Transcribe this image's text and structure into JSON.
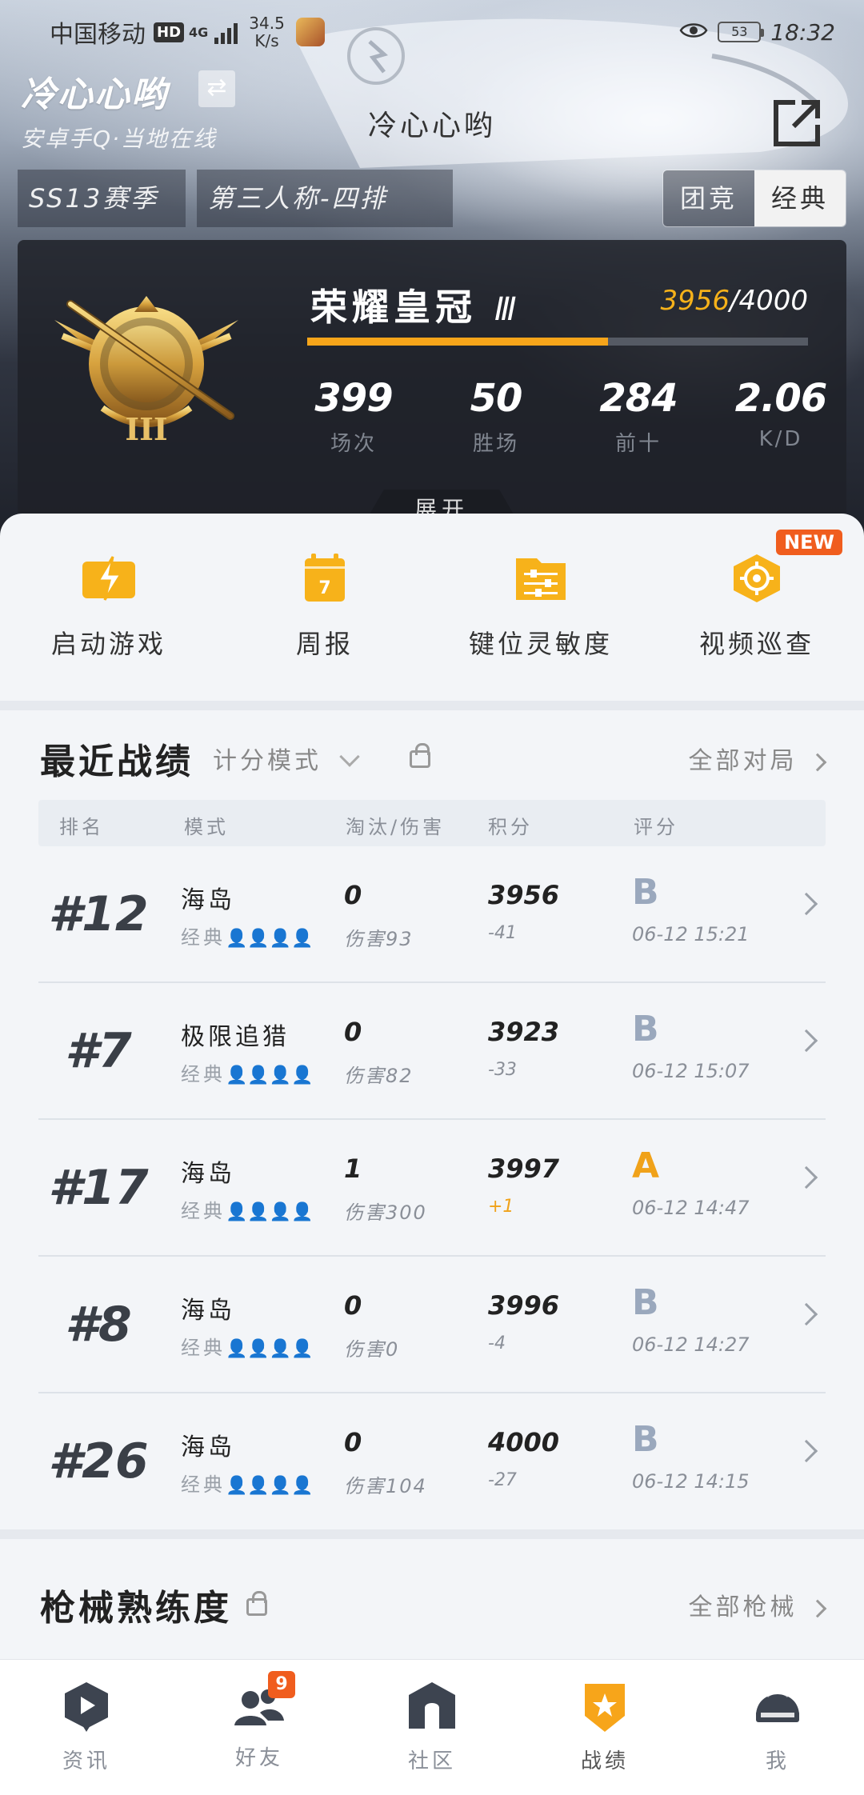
{
  "status_bar": {
    "carrier": "中国移动",
    "hd": "HD",
    "network": "4G",
    "speed_value": "34.5",
    "speed_unit": "K/s",
    "battery": "53",
    "time": "18:32"
  },
  "header": {
    "player_name": "冷心心哟",
    "online_status": "安卓手Q·当地在线",
    "title": "冷心心哟"
  },
  "filters": {
    "season": "SS13赛季",
    "mode": "第三人称-四排",
    "segments": [
      "团竞",
      "经典"
    ],
    "selected_segment": "经典"
  },
  "rank": {
    "name": "荣耀皇冠",
    "level": "Ⅲ",
    "badge_numeral": "III",
    "score_current": "3956",
    "score_max": "/4000",
    "progress": 0.6,
    "stats": [
      {
        "value": "399",
        "label": "场次"
      },
      {
        "value": "50",
        "label": "胜场"
      },
      {
        "value": "284",
        "label": "前十"
      },
      {
        "value": "2.06",
        "label": "K/D"
      }
    ],
    "expand_label": "展开"
  },
  "quick_actions": [
    {
      "label": "启动游戏",
      "icon": "lightning-icon"
    },
    {
      "label": "周报",
      "icon": "calendar-icon",
      "day": "7"
    },
    {
      "label": "键位灵敏度",
      "icon": "sliders-icon"
    },
    {
      "label": "视频巡查",
      "icon": "target-icon"
    }
  ],
  "new_tag": "NEW",
  "recent": {
    "title": "最近战绩",
    "mode_filter": "计分模式",
    "more": "全部对局",
    "columns": [
      "排名",
      "模式",
      "淘汰/伤害",
      "积分",
      "评分"
    ],
    "rows": [
      {
        "rank": "#12",
        "map": "海岛",
        "mode": "经典",
        "kills": "0",
        "damage": "伤害93",
        "points": "3956",
        "delta": "-41",
        "grade": "B",
        "time": "06-12 15:21"
      },
      {
        "rank": "#7",
        "map": "极限追猎",
        "mode": "经典",
        "kills": "0",
        "damage": "伤害82",
        "points": "3923",
        "delta": "-33",
        "grade": "B",
        "time": "06-12 15:07"
      },
      {
        "rank": "#17",
        "map": "海岛",
        "mode": "经典",
        "kills": "1",
        "damage": "伤害300",
        "points": "3997",
        "delta": "+1",
        "grade": "A",
        "time": "06-12 14:47"
      },
      {
        "rank": "#8",
        "map": "海岛",
        "mode": "经典",
        "kills": "0",
        "damage": "伤害0",
        "points": "3996",
        "delta": "-4",
        "grade": "B",
        "time": "06-12 14:27"
      },
      {
        "rank": "#26",
        "map": "海岛",
        "mode": "经典",
        "kills": "0",
        "damage": "伤害104",
        "points": "4000",
        "delta": "-27",
        "grade": "B",
        "time": "06-12 14:15"
      }
    ]
  },
  "weapons": {
    "title": "枪械熟练度",
    "more": "全部枪械"
  },
  "bottom_nav": {
    "items": [
      {
        "label": "资讯"
      },
      {
        "label": "好友",
        "badge": "9"
      },
      {
        "label": "社区"
      },
      {
        "label": "战绩"
      },
      {
        "label": "我"
      }
    ],
    "active": "战绩"
  },
  "colors": {
    "accent": "#f7a51a",
    "new_tag": "#f05d1e",
    "grade_a": "#f0a21a",
    "grade_b": "#9aa8bd"
  }
}
